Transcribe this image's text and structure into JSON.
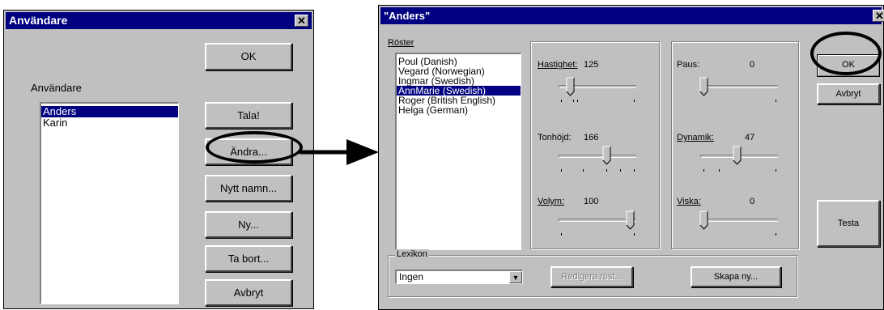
{
  "users_dialog": {
    "title": "Användare",
    "ok_label": "OK",
    "list_label": "Användare",
    "users": [
      "Anders",
      "Karin"
    ],
    "speak_label": "Tala!",
    "change_label": "Ändra...",
    "new_name_label": "Nytt namn...",
    "new_label": "Ny...",
    "remove_label": "Ta bort...",
    "cancel_label": "Avbryt"
  },
  "voice_dialog": {
    "title": "\"Anders\"",
    "voices_label": "Röster",
    "voices": [
      "Poul (Danish)",
      "Vegard (Norwegian)",
      "Ingmar (Swedish)",
      "AnnMarie (Swedish)",
      "Roger (British English)",
      "Helga (German)"
    ],
    "selected_voice_index": 3,
    "sliders": {
      "speed": {
        "label": "Hastighet:",
        "value": "125"
      },
      "pitch": {
        "label": "Tonhöjd:",
        "value": "166"
      },
      "volume": {
        "label": "Volym:",
        "value": "100"
      },
      "pause": {
        "label": "Paus:",
        "value": "0"
      },
      "dynamics": {
        "label": "Dynamik:",
        "value": "47"
      },
      "whisper": {
        "label": "Viska:",
        "value": "0"
      }
    },
    "ok_label": "OK",
    "cancel_label": "Avbryt",
    "test_label": "Testa",
    "lexicon_group_label": "Lexikon",
    "lexicon_selected": "Ingen",
    "edit_voice_label": "Redigera röst...",
    "create_new_label": "Skapa ny..."
  },
  "colors": {
    "face": "#c0c0c0",
    "titlebar": "#000080",
    "selection": "#000080"
  }
}
